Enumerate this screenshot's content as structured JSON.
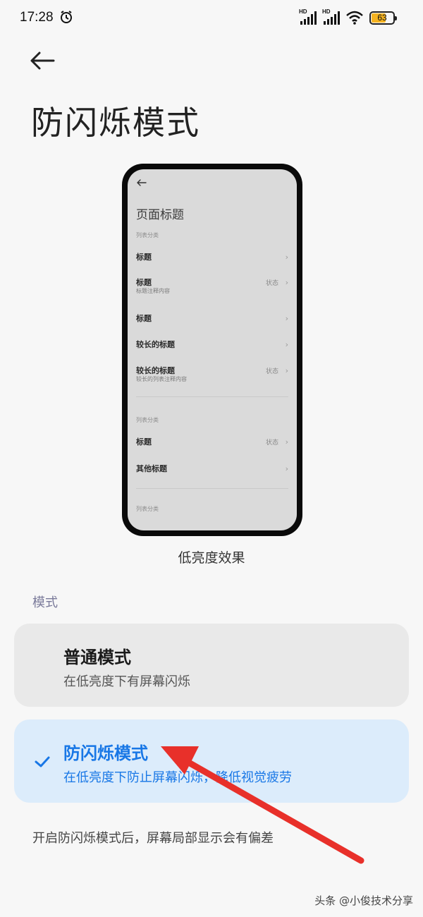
{
  "status_bar": {
    "time": "17:28",
    "battery_level": "63",
    "battery_fraction": 0.63,
    "signal_label": "HD",
    "icons": [
      "alarm-icon",
      "signal-icon",
      "signal-icon",
      "wifi-icon",
      "battery-icon"
    ]
  },
  "header": {
    "back_icon": "back-arrow-icon",
    "title": "防闪烁模式"
  },
  "preview": {
    "back_icon": "back-arrow-icon",
    "page_title": "页面标题",
    "rows": [
      {
        "category": "列表分类"
      },
      {
        "title": "标题",
        "chevron": "›"
      },
      {
        "title": "标题",
        "subtitle": "标题注释内容",
        "status": "状态",
        "chevron": "›"
      },
      {
        "title": "标题",
        "chevron": "›"
      },
      {
        "title": "较长的标题",
        "chevron": "›"
      },
      {
        "title": "较长的标题",
        "subtitle": "较长的列表注释内容",
        "status": "状态",
        "chevron": "›"
      },
      {
        "category": "列表分类"
      },
      {
        "title": "标题",
        "status": "状态",
        "chevron": "›"
      },
      {
        "title": "其他标题",
        "chevron": "›"
      },
      {
        "category": "列表分类"
      }
    ],
    "caption": "低亮度效果"
  },
  "mode_section": {
    "label": "模式",
    "options": [
      {
        "title": "普通模式",
        "description": "在低亮度下有屏幕闪烁",
        "selected": false
      },
      {
        "title": "防闪烁模式",
        "description": "在低亮度下防止屏幕闪烁，降低视觉疲劳",
        "selected": true,
        "check_icon": "checkmark-icon"
      }
    ]
  },
  "footnote": "开启防闪烁模式后，屏幕局部显示会有偏差",
  "watermark": "头条 @小俊技术分享",
  "colors": {
    "accent": "#1877e6",
    "selected_card_bg": "#dcecfb",
    "annotation_arrow": "#e8302a"
  }
}
